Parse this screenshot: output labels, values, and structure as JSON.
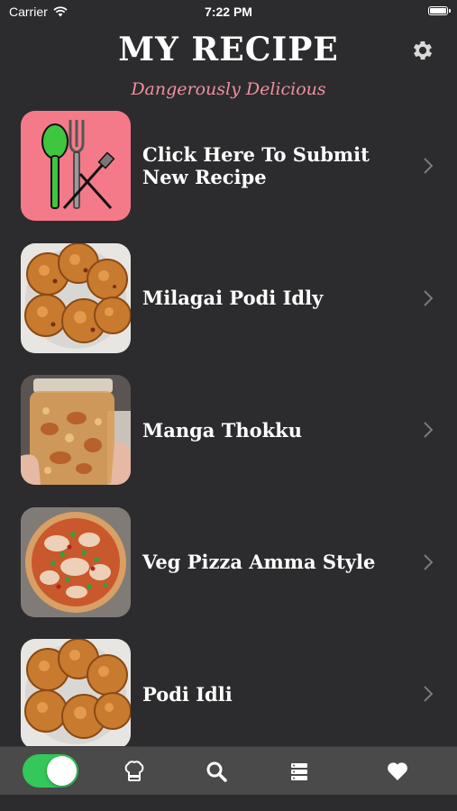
{
  "status_bar": {
    "carrier": "Carrier",
    "time": "7:22 PM"
  },
  "header": {
    "title": "MY RECIPE",
    "subtitle": "Dangerously Delicious"
  },
  "recipes": [
    {
      "label": "Click Here To Submit New Recipe",
      "thumb": "submit-recipe-icon"
    },
    {
      "label": "Milagai Podi Idly",
      "thumb": "idly-photo"
    },
    {
      "label": "Manga Thokku",
      "thumb": "pickle-jar-photo"
    },
    {
      "label": "Veg Pizza Amma Style",
      "thumb": "pizza-photo"
    },
    {
      "label": "Podi Idli",
      "thumb": "idly-photo"
    }
  ],
  "tab_bar": {
    "toggle_on": true,
    "tabs": [
      "chef-hat-icon",
      "search-icon",
      "list-icon",
      "heart-icon"
    ]
  },
  "colors": {
    "background": "#2c2c2e",
    "subtitle": "#f08fa0",
    "toggle": "#34c759",
    "submit_tile": "#f47a8a"
  }
}
